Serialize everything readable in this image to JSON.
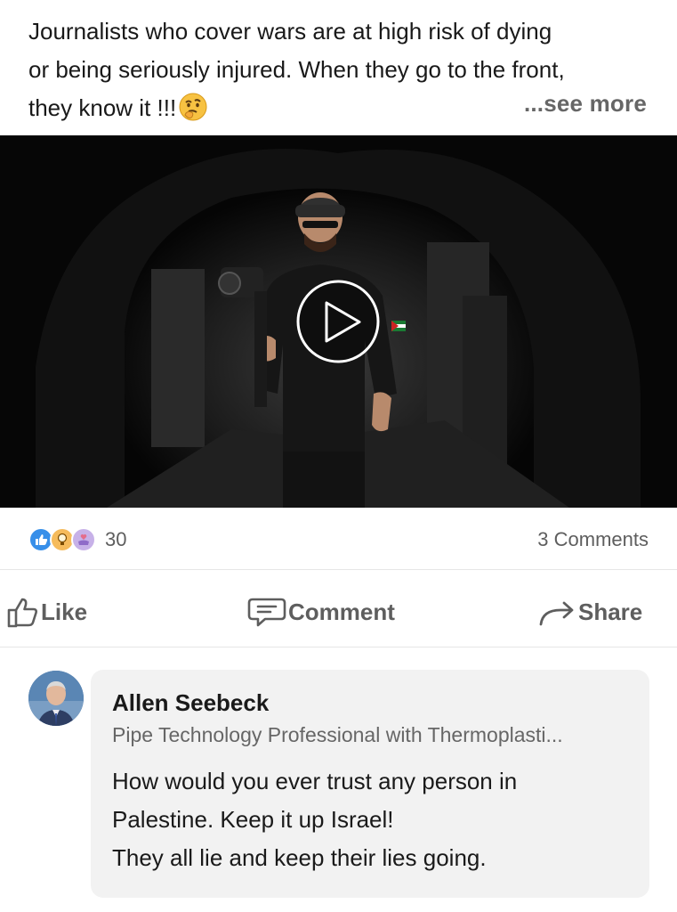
{
  "post": {
    "text_lines": [
      "Journalists who cover wars are at high risk of dying",
      "or being seriously injured. When they go to the front,",
      "they know it !!!"
    ],
    "see_more": "...see more"
  },
  "video": {
    "play_icon": "play-icon"
  },
  "social": {
    "reactions": [
      "like-reaction-icon",
      "insightful-reaction-icon",
      "support-reaction-icon"
    ],
    "reaction_count": "30",
    "comments_count": "3 Comments"
  },
  "actions": {
    "like": "Like",
    "comment": "Comment",
    "share": "Share"
  },
  "comment": {
    "author": "Allen Seebeck",
    "headline": "Pipe Technology Professional with Thermoplasti...",
    "body_lines": [
      "How would you ever trust any person in",
      "Palestine. Keep it up Israel!",
      "They all lie and keep their lies going."
    ]
  },
  "colors": {
    "text": "#191919",
    "muted": "#5e5e5e",
    "like_blue": "#378fe9",
    "insight_yellow": "#f5bb5c",
    "support_purple": "#c7b1e8",
    "bubble_bg": "#f2f2f2"
  }
}
